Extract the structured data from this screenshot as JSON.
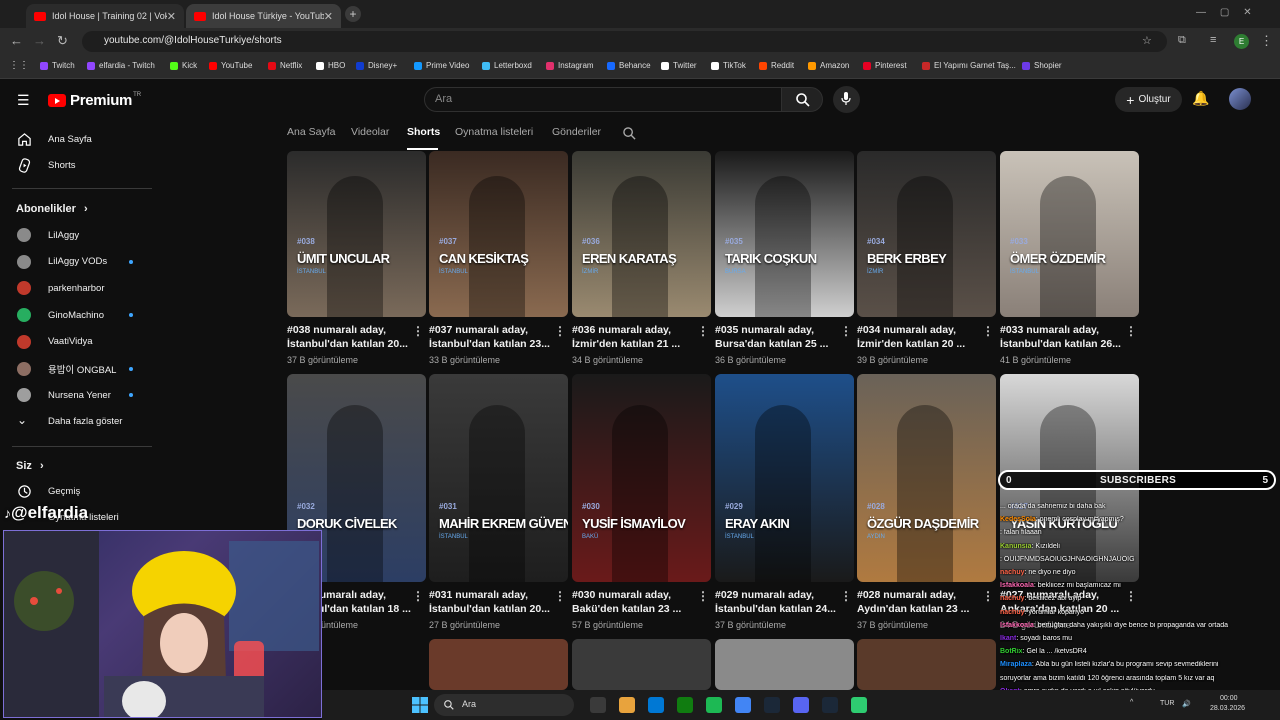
{
  "browser": {
    "tabs": [
      {
        "title": "Idol House | Training 02 | Vokal"
      },
      {
        "title": "Idol House Türkiye - YouTube"
      }
    ],
    "url": "youtube.com/@IdolHouseTurkiye/shorts",
    "bookmarks": [
      {
        "label": "Twitch",
        "color": "#9146ff"
      },
      {
        "label": "elfardia - Twitch",
        "color": "#9146ff"
      },
      {
        "label": "Kick",
        "color": "#53fc18"
      },
      {
        "label": "YouTube",
        "color": "#ff0000"
      },
      {
        "label": "Netflix",
        "color": "#e50914"
      },
      {
        "label": "HBO",
        "color": "#ffffff"
      },
      {
        "label": "Disney+",
        "color": "#113ccf"
      },
      {
        "label": "Prime Video",
        "color": "#1399ff"
      },
      {
        "label": "Letterboxd",
        "color": "#40bcf4"
      },
      {
        "label": "Instagram",
        "color": "#e1306c"
      },
      {
        "label": "Behance",
        "color": "#1769ff"
      },
      {
        "label": "Twitter",
        "color": "#ffffff"
      },
      {
        "label": "TikTok",
        "color": "#ffffff"
      },
      {
        "label": "Reddit",
        "color": "#ff4500"
      },
      {
        "label": "Amazon",
        "color": "#ff9900"
      },
      {
        "label": "Pinterest",
        "color": "#e60023"
      },
      {
        "label": "El Yapımı Garnet Taş...",
        "color": "#c62828"
      },
      {
        "label": "Shopier",
        "color": "#6c3ae8"
      }
    ],
    "profile_initial": "E"
  },
  "header": {
    "logo": "Premium",
    "logo_sup": "TR",
    "search_placeholder": "Ara",
    "create_label": "Oluştur"
  },
  "sidebar": {
    "main": [
      {
        "label": "Ana Sayfa"
      },
      {
        "label": "Shorts"
      }
    ],
    "subs_title": "Abonelikler",
    "subs": [
      {
        "label": "LilAggy",
        "color": "#8a8a8a",
        "dot": false
      },
      {
        "label": "LilAggy VODs",
        "color": "#8a8a8a",
        "dot": true
      },
      {
        "label": "parkenharbor",
        "color": "#c0392b",
        "dot": false
      },
      {
        "label": "GinoMachino",
        "color": "#27ae60",
        "dot": true
      },
      {
        "label": "VaatiVidya",
        "color": "#c0392b",
        "dot": false
      },
      {
        "label": "용밥이 ONGBAL",
        "color": "#8d6e63",
        "dot": true
      },
      {
        "label": "Nursena Yener",
        "color": "#9e9e9e",
        "dot": true
      }
    ],
    "show_more": "Daha fazla göster",
    "you_title": "Siz",
    "you_items": [
      {
        "label": "Geçmiş"
      },
      {
        "label": "Oynatma listeleri"
      }
    ]
  },
  "channel_tabs": [
    {
      "label": "Ana Sayfa"
    },
    {
      "label": "Videolar"
    },
    {
      "label": "Shorts"
    },
    {
      "label": "Oynatma listeleri"
    },
    {
      "label": "Gönderiler"
    }
  ],
  "shorts_row1": [
    {
      "num": "#038",
      "name": "ÜMIT UNCULAR",
      "city": "İSTANBUL",
      "cap1": "#038 numaralı aday,",
      "cap2": "İstanbul'dan katılan 20...",
      "views": "37 B görüntüleme",
      "bg1": "#2b2b2b",
      "bg2": "#7a6a5a"
    },
    {
      "num": "#037",
      "name": "CAN KESİKTAŞ",
      "city": "İSTANBUL",
      "cap1": "#037 numaralı aday,",
      "cap2": "İstanbul'dan katılan 23...",
      "views": "33 B görüntüleme",
      "bg1": "#3a2a22",
      "bg2": "#8a6a50"
    },
    {
      "num": "#036",
      "name": "EREN KARATAŞ",
      "city": "İZMİR",
      "cap1": "#036 numaralı aday,",
      "cap2": "İzmir'den katılan 21 ...",
      "views": "34 B görüntüleme",
      "bg1": "#3a3a34",
      "bg2": "#9a8a70"
    },
    {
      "num": "#035",
      "name": "TARIK COŞKUN",
      "city": "BURSA",
      "cap1": "#035 numaralı aday,",
      "cap2": "Bursa'dan katılan 25 ...",
      "views": "36 B görüntüleme",
      "bg1": "#1a1a1a",
      "bg2": "#cfcfcf"
    },
    {
      "num": "#034",
      "name": "BERK ERBEY",
      "city": "İZMİR",
      "cap1": "#034 numaralı aday,",
      "cap2": "İzmir'den katılan 20 ...",
      "views": "39 B görüntüleme",
      "bg1": "#2a2a2a",
      "bg2": "#5a5048"
    },
    {
      "num": "#033",
      "name": "ÖMER ÖZDEMİR",
      "city": "İSTANBUL",
      "cap1": "#033 numaralı aday,",
      "cap2": "İstanbul'dan katılan 26...",
      "views": "41 B görüntüleme",
      "bg1": "#c9c2b8",
      "bg2": "#8a8078"
    }
  ],
  "shorts_row2": [
    {
      "num": "#032",
      "name": "DORUK CİVELEK",
      "city": "",
      "cap1": "#032 numaralı aday,",
      "cap2": "İstanbul'dan katılan 18 ...",
      "views": "37 B görüntüleme",
      "bg1": "#4a4a4a",
      "bg2": "#2c3e64"
    },
    {
      "num": "#031",
      "name": "MAHİR EKREM GÜVEN",
      "city": "İSTANBUL",
      "cap1": "#031 numaralı aday,",
      "cap2": "İstanbul'dan katılan 20...",
      "views": "27 B görüntüleme",
      "bg1": "#3a3a3a",
      "bg2": "#1e1e1e"
    },
    {
      "num": "#030",
      "name": "YUSİF İSMAYİLOV",
      "city": "BAKÜ",
      "cap1": "#030 numaralı aday,",
      "cap2": "Bakü'den katılan 23 ...",
      "views": "57 B görüntüleme",
      "bg1": "#1a1a1a",
      "bg2": "#6a1a1a"
    },
    {
      "num": "#029",
      "name": "ERAY AKIN",
      "city": "İSTANBUL",
      "cap1": "#029 numaralı aday,",
      "cap2": "İstanbul'dan katılan 24...",
      "views": "37 B görüntüleme",
      "bg1": "#1e4f8a",
      "bg2": "#1a1a1a"
    },
    {
      "num": "#028",
      "name": "ÖZGÜR DAŞDEMİR",
      "city": "AYDIN",
      "cap1": "#028 numaralı aday,",
      "cap2": "Aydın'dan katılan 23 ...",
      "views": "37 B görüntüleme",
      "bg1": "#6a6258",
      "bg2": "#b07a40"
    },
    {
      "num": "#027",
      "name": "YASIN KURTOĞLU",
      "city": "",
      "cap1": "#027 numaralı aday,",
      "cap2": "Ankara'dan katılan 20 ...",
      "views": "24 B görüntüleme",
      "bg1": "#d8d8d8",
      "bg2": "#3a3a3a"
    }
  ],
  "overlay": {
    "handle": "@elfardia",
    "subs_left": "0",
    "subs_title": "SUBSCRIBERS",
    "subs_right": "5",
    "chat": [
      {
        "user": "",
        "user_color": "#ffffff",
        "msg": "... orada da sahnemiz bi daha bak"
      },
      {
        "user": "KedeşSola",
        "user_color": "#ff8c00",
        "msg": ": onemli cosplay mi yapmış?"
      },
      {
        "user": "",
        "user_color": "#ffffff",
        "msg": ": falan filaaan"
      },
      {
        "user": "Kanunsia",
        "user_color": "#9acd32",
        "msg": ": Kızıldeli"
      },
      {
        "user": "",
        "user_color": "#ffffff",
        "msg": ": OUIJFNMDSAOIUGJHNAOIGHNJAUOIG"
      },
      {
        "user": "nachuy",
        "user_color": "#ff6347",
        "msg": ": ne diyo ne diyo"
      },
      {
        "user": "Isfakkoala",
        "user_color": "#ff69b4",
        "msg": ": bekliicez mi başlamıcaz mı"
      },
      {
        "user": "nachuy",
        "user_color": "#ff6347",
        "msg": ": bekliicez abi ayip"
      },
      {
        "user": "nachuy",
        "user_color": "#ff6347",
        "msg": ": yorumlar kopariyo"
      },
      {
        "user": "Isfakkoala",
        "user_color": "#ff69b4",
        "msg": ": bertuğfan daha yakışıklı diye bence bi propaganda var ortada"
      },
      {
        "user": "Ikant",
        "user_color": "#8a2be2",
        "msg": ": soyadı baros mu"
      },
      {
        "user": "BotRix",
        "user_color": "#32cd32",
        "msg": ": Gel la ... /ketvsDR4"
      },
      {
        "user": "Miraplaza",
        "user_color": "#1e90ff",
        "msg": ": Abla bu gün listeli kızlar'a bu programı sevip sevmediklerini"
      },
      {
        "user": "",
        "user_color": "#ffffff",
        "msg": "soruyorlar ama bizim katıldı 120 öğrenci arasında toplam 5 kız var aq"
      },
      {
        "user": "Okant",
        "user_color": "#8a2be2",
        "msg": ": emre aydın da vardı o yıl çekip söylüyordu"
      },
      {
        "user": "nachuy",
        "user_color": "#ff6347",
        "msg": ": jiosajmgoiasjgmoia"
      }
    ]
  },
  "taskbar": {
    "search": "Ara",
    "lang": "TUR",
    "time": "00:00",
    "date": "28.03.2026",
    "apps": [
      {
        "color": "#3a3a3a"
      },
      {
        "color": "#e8a33d"
      },
      {
        "color": "#0078d4"
      },
      {
        "color": "#107c10"
      },
      {
        "color": "#1db954"
      },
      {
        "color": "#4285f4"
      },
      {
        "color": "#1b2838"
      },
      {
        "color": "#5865f2"
      },
      {
        "color": "#1b2838"
      },
      {
        "color": "#2ecc71"
      }
    ]
  }
}
